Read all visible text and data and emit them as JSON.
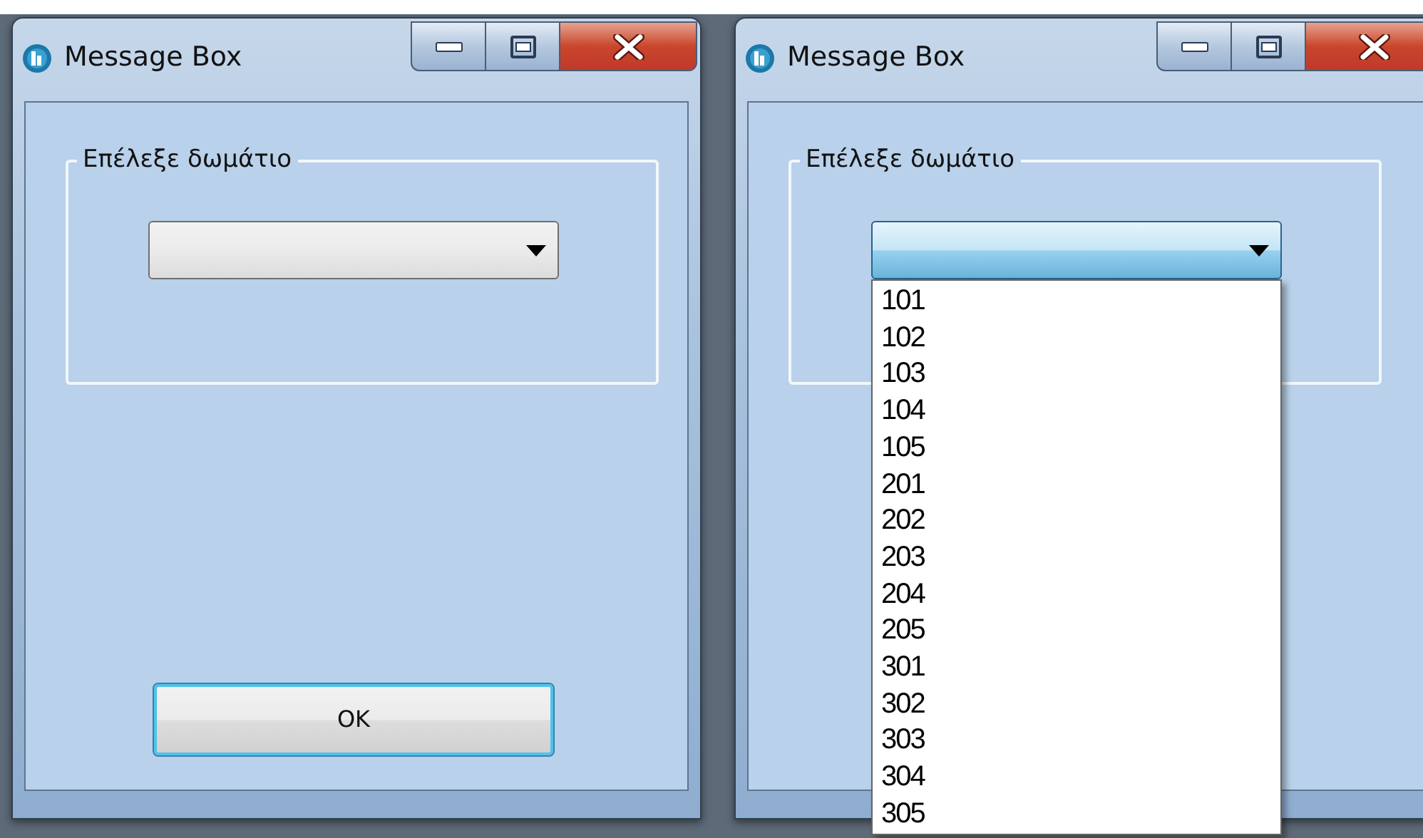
{
  "windows": [
    {
      "title": "Message Box",
      "group_label": "Επέλεξε δωμάτιο",
      "combo": {
        "expanded": false
      },
      "button": "OK"
    },
    {
      "title": "Message Box",
      "group_label": "Επέλεξε δωμάτιο",
      "combo": {
        "expanded": true,
        "items": [
          "101",
          "102",
          "103",
          "104",
          "105",
          "201",
          "202",
          "203",
          "204",
          "205",
          "301",
          "302",
          "303",
          "304",
          "305"
        ]
      }
    }
  ]
}
